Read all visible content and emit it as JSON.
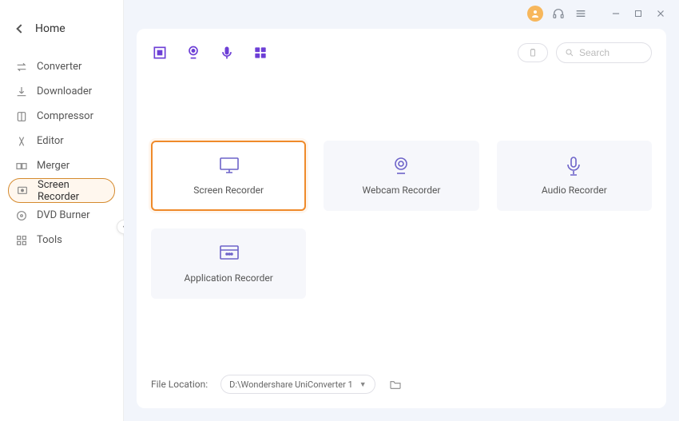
{
  "header": {
    "home_label": "Home"
  },
  "sidebar": {
    "items": [
      {
        "id": "converter",
        "label": "Converter",
        "icon": "converter-icon"
      },
      {
        "id": "downloader",
        "label": "Downloader",
        "icon": "downloader-icon"
      },
      {
        "id": "compressor",
        "label": "Compressor",
        "icon": "compressor-icon"
      },
      {
        "id": "editor",
        "label": "Editor",
        "icon": "editor-icon"
      },
      {
        "id": "merger",
        "label": "Merger",
        "icon": "merger-icon"
      },
      {
        "id": "screen-recorder",
        "label": "Screen Recorder",
        "icon": "screen-recorder-icon",
        "selected": true
      },
      {
        "id": "dvd-burner",
        "label": "DVD Burner",
        "icon": "dvd-burner-icon"
      },
      {
        "id": "tools",
        "label": "Tools",
        "icon": "tools-icon"
      }
    ]
  },
  "toolbar": {
    "modes": [
      "screen-mode",
      "webcam-mode",
      "audio-mode",
      "app-mode"
    ],
    "clipboard_btn": "clipboard",
    "search_placeholder": "Search"
  },
  "recorder_cards": [
    {
      "id": "screen-recorder-card",
      "label": "Screen Recorder",
      "icon": "monitor-icon",
      "selected": true
    },
    {
      "id": "webcam-recorder-card",
      "label": "Webcam Recorder",
      "icon": "webcam-icon"
    },
    {
      "id": "audio-recorder-card",
      "label": "Audio Recorder",
      "icon": "mic-icon"
    },
    {
      "id": "application-recorder-card",
      "label": "Application Recorder",
      "icon": "window-icon"
    }
  ],
  "footer": {
    "file_location_label": "File Location:",
    "path_value": "D:\\Wondershare UniConverter 1"
  }
}
